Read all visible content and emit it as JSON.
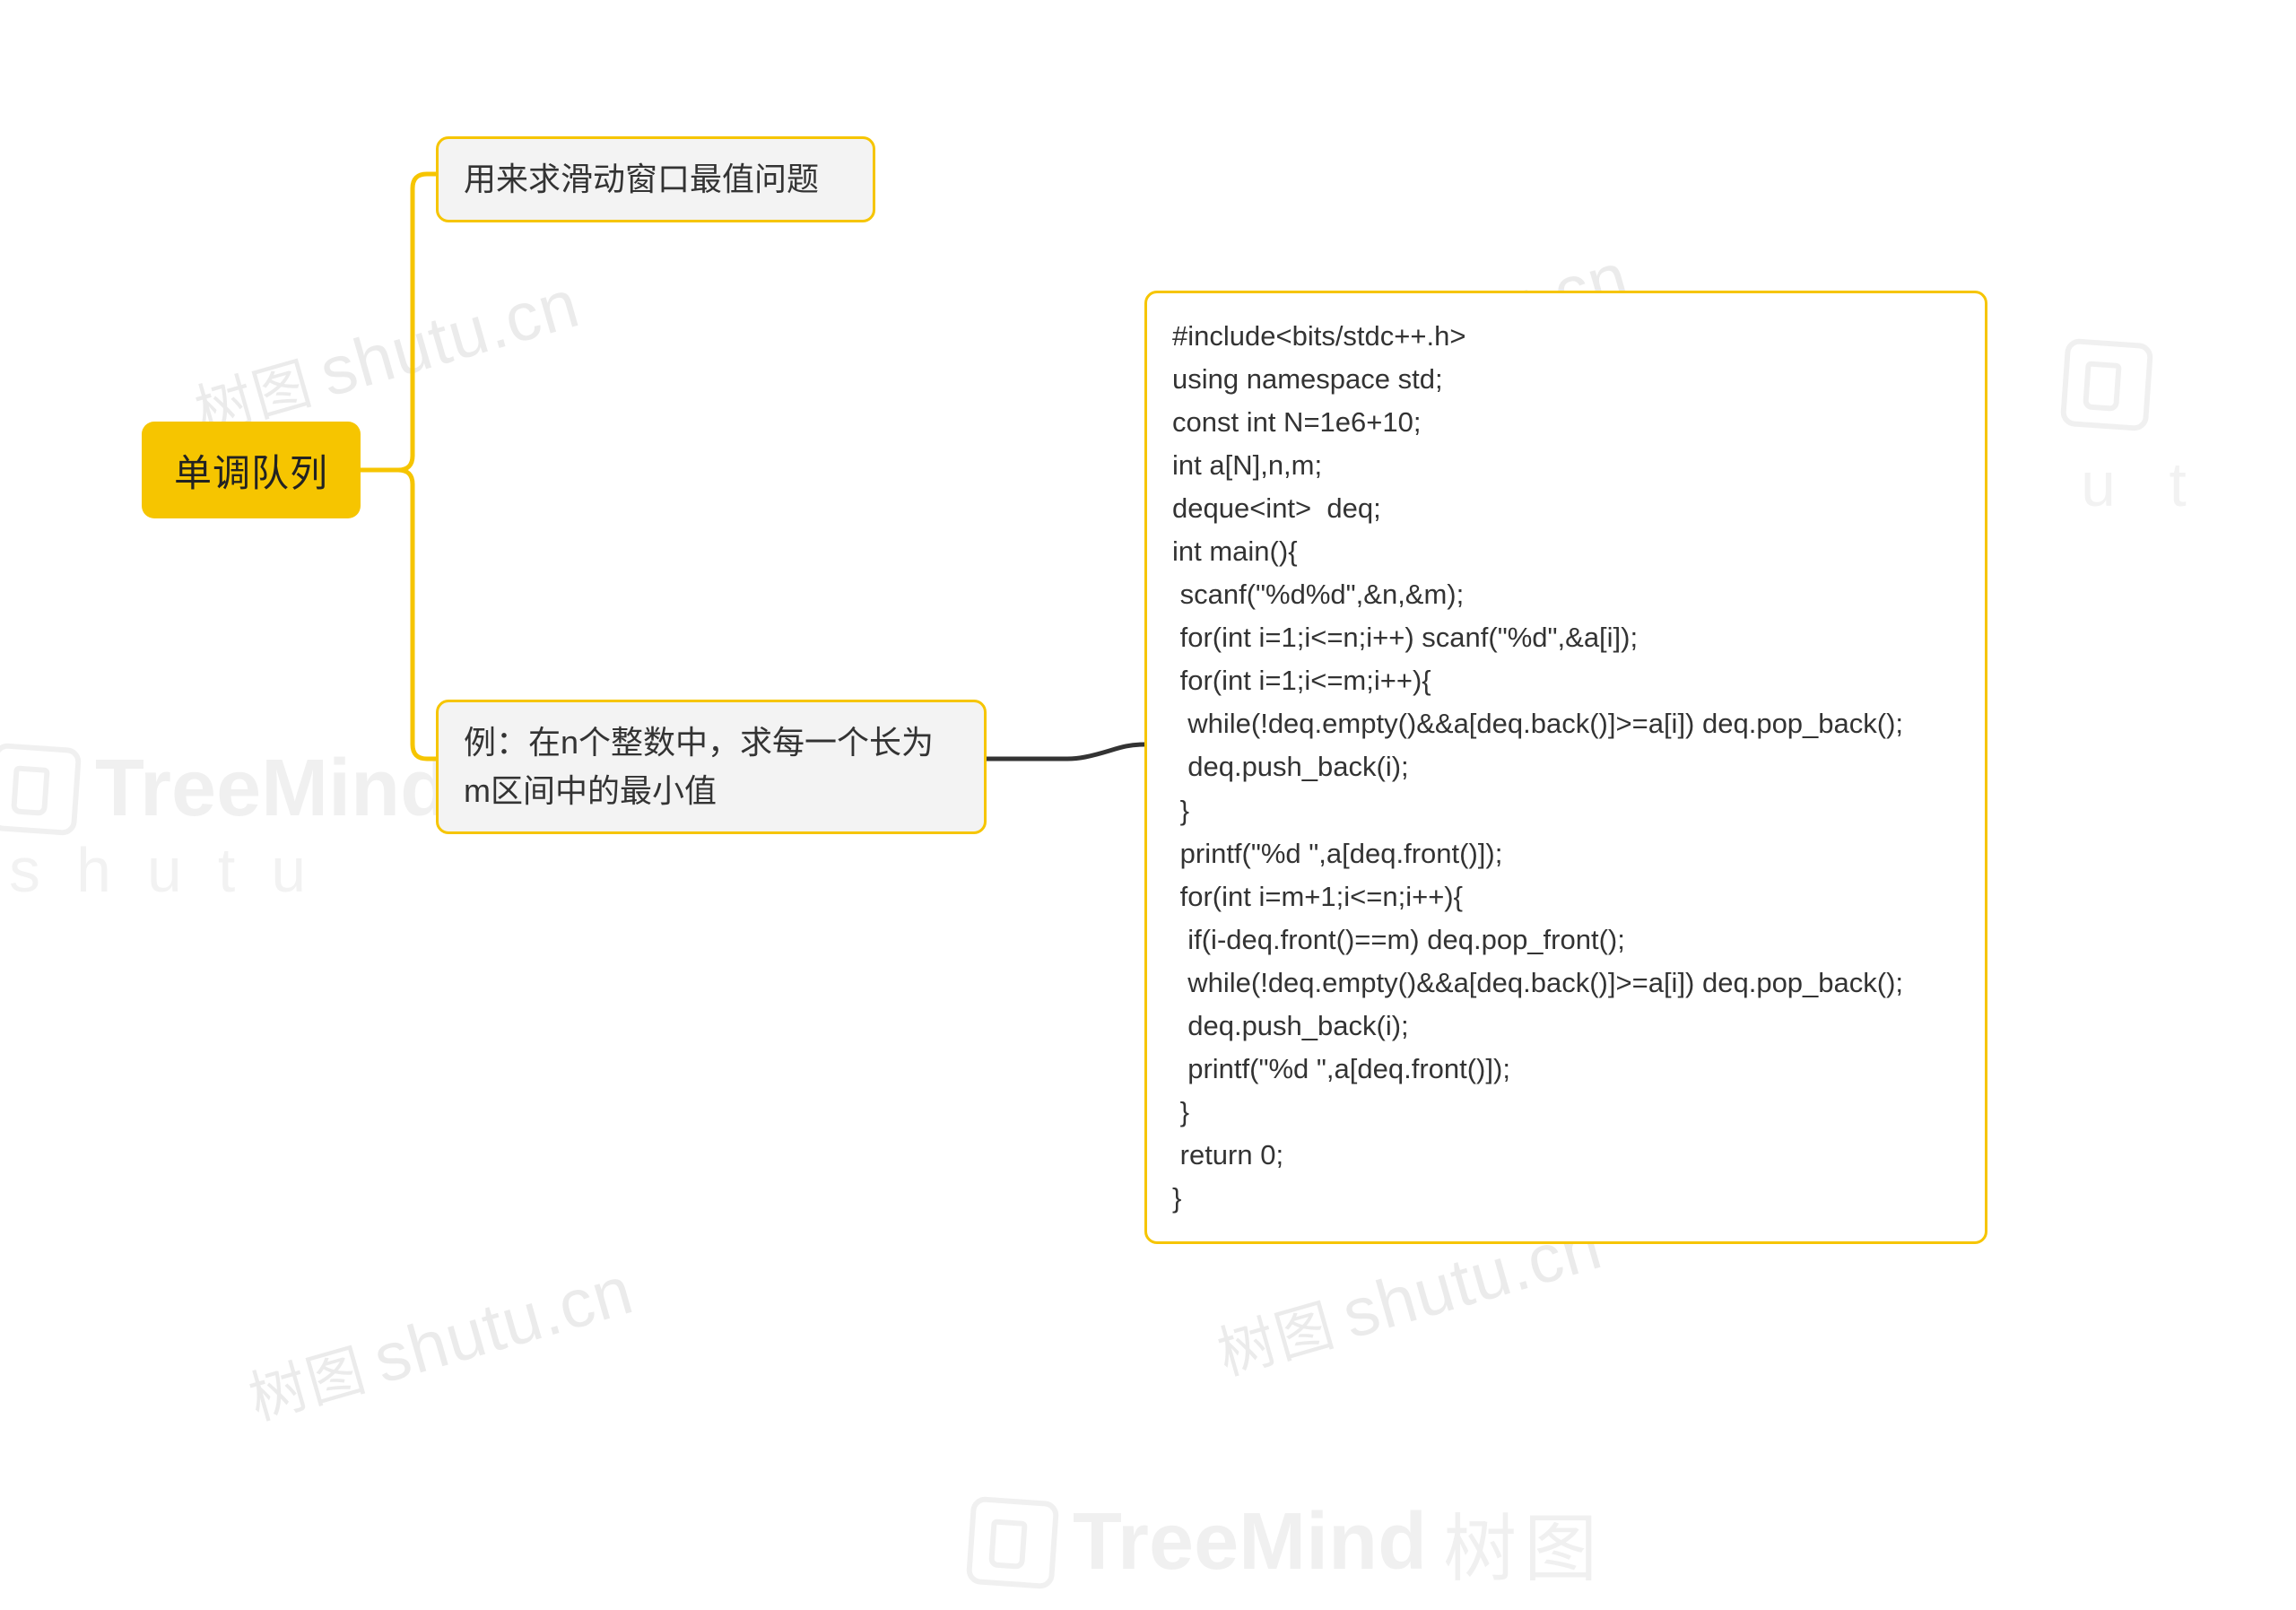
{
  "root": {
    "label": "单调队列"
  },
  "children": [
    {
      "id": "n1",
      "label": "用来求滑动窗口最值问题"
    },
    {
      "id": "n2",
      "label": "例：在n个整数中，求每一个长为m区间中的最小值",
      "children": [
        {
          "id": "n3",
          "code": "#include<bits/stdc++.h>\nusing namespace std;\nconst int N=1e6+10;\nint a[N],n,m;\ndeque<int>  deq;\nint main(){\n scanf(\"%d%d\",&n,&m);\n for(int i=1;i<=n;i++) scanf(\"%d\",&a[i]);\n for(int i=1;i<=m;i++){\n  while(!deq.empty()&&a[deq.back()]>=a[i]) deq.pop_back();\n  deq.push_back(i);\n }\n printf(\"%d \",a[deq.front()]);\n for(int i=m+1;i<=n;i++){\n  if(i-deq.front()==m) deq.pop_front();\n  while(!deq.empty()&&a[deq.back()]>=a[i]) deq.pop_back();\n  deq.push_back(i);\n  printf(\"%d \",a[deq.front()]);\n }\n return 0;\n}"
        }
      ]
    }
  ],
  "watermark": {
    "text_cn": "树图",
    "text_en": "shutu.cn",
    "brand": "TreeMind",
    "brand_zh": "树图",
    "sub": "shutu"
  }
}
